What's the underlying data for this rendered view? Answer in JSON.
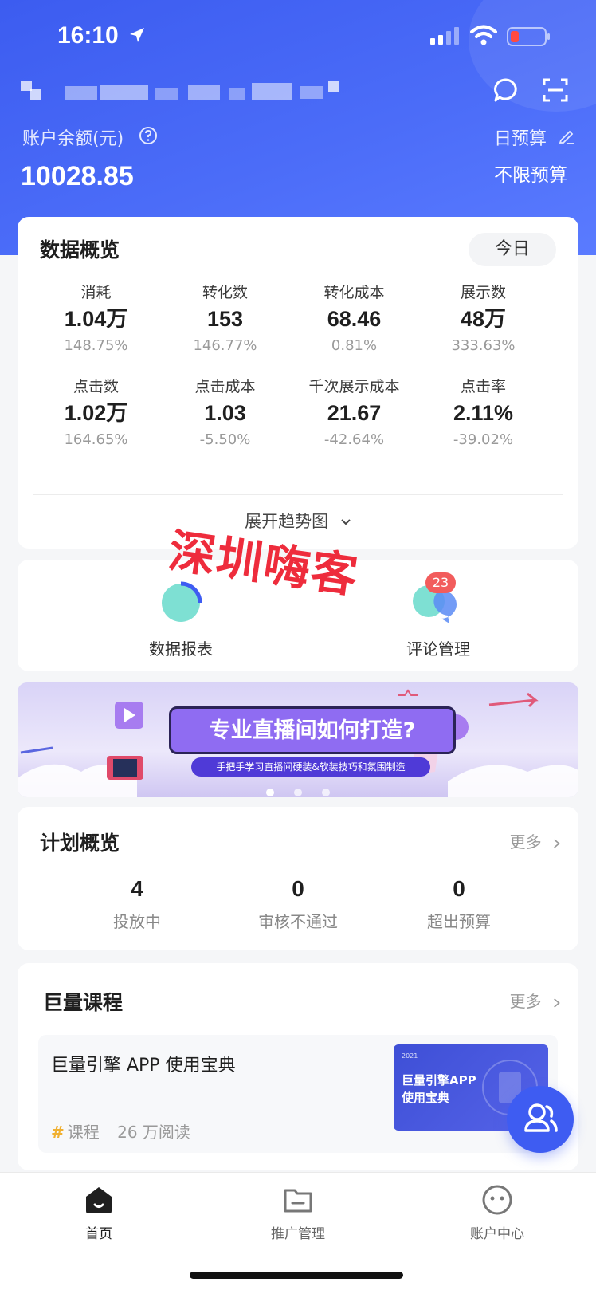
{
  "status_bar": {
    "time": "16:10"
  },
  "header": {
    "balance_label": "账户余额(元)",
    "balance_value": "10028.85",
    "budget_label": "日预算",
    "budget_value": "不限预算"
  },
  "overview": {
    "title": "数据概览",
    "period_button": "今日",
    "metrics": [
      {
        "label": "消耗",
        "value": "1.04万",
        "change": "148.75%"
      },
      {
        "label": "转化数",
        "value": "153",
        "change": "146.77%"
      },
      {
        "label": "转化成本",
        "value": "68.46",
        "change": "0.81%"
      },
      {
        "label": "展示数",
        "value": "48万",
        "change": "333.63%"
      },
      {
        "label": "点击数",
        "value": "1.02万",
        "change": "164.65%"
      },
      {
        "label": "点击成本",
        "value": "1.03",
        "change": "-5.50%"
      },
      {
        "label": "千次展示成本",
        "value": "21.67",
        "change": "-42.64%"
      },
      {
        "label": "点击率",
        "value": "2.11%",
        "change": "-39.02%"
      }
    ],
    "expand_label": "展开趋势图"
  },
  "tools": {
    "items": [
      {
        "label": "数据报表"
      },
      {
        "label": "评论管理",
        "badge": "23"
      }
    ]
  },
  "watermark": "深圳嗨客",
  "banner": {
    "headline": "专业直播间如何打造?",
    "subline": "手把手学习直播间硬装&软装技巧和氛围制造"
  },
  "plans": {
    "title": "计划概览",
    "more_label": "更多",
    "stats": [
      {
        "value": "4",
        "label": "投放中"
      },
      {
        "value": "0",
        "label": "审核不通过"
      },
      {
        "value": "0",
        "label": "超出预算"
      }
    ]
  },
  "courses": {
    "title": "巨量课程",
    "more_label": "更多",
    "item": {
      "title": "巨量引擎 APP 使用宝典",
      "tag": "课程",
      "reads": "26 万阅读",
      "thumb_year": "2021",
      "thumb_title_line1": "巨量引擎APP",
      "thumb_title_line2": "使用宝典"
    }
  },
  "tabbar": {
    "tabs": [
      {
        "label": "首页"
      },
      {
        "label": "推广管理"
      },
      {
        "label": "账户中心"
      }
    ]
  },
  "colors": {
    "brand_blue": "#3e5cf2",
    "badge_red": "#f25c5c",
    "watermark_red": "#ee2c3c"
  }
}
